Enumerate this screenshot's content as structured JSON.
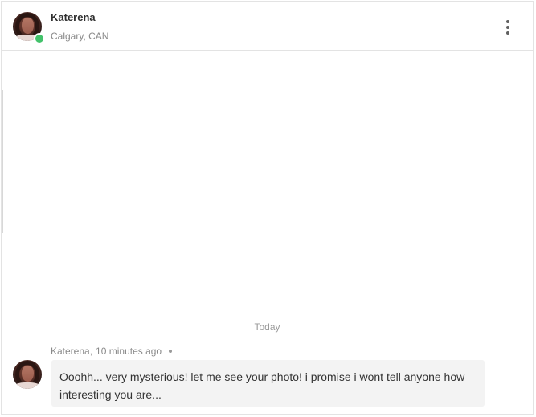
{
  "header": {
    "contact_name": "Katerena",
    "contact_location": "Calgary, CAN",
    "online": true,
    "more_icon": "more-vertical-icon"
  },
  "conversation": {
    "date_divider": "Today",
    "messages": [
      {
        "sender": "Katerena",
        "sender_suffix": ",",
        "time": "10 minutes ago",
        "text": "Ooohh... very mysterious! let me see your photo! i promise i wont tell anyone how interesting you are..."
      }
    ]
  },
  "colors": {
    "online_indicator": "#43c26b",
    "bubble_background": "#f3f3f3",
    "border": "#e3e3e3"
  }
}
